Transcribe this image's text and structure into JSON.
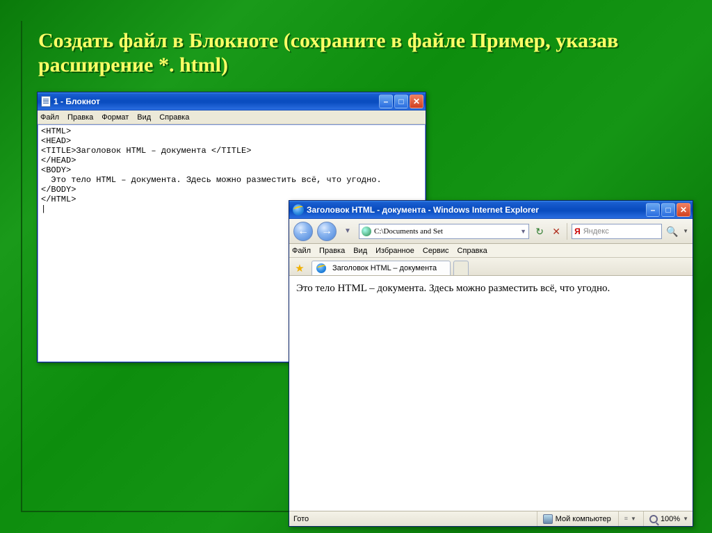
{
  "slide": {
    "title": "Создать файл в Блокноте (сохраните в файле Пример,  указав расширение  *. html)"
  },
  "notepad": {
    "title": "1 - Блокнот",
    "menu": {
      "file": "Файл",
      "edit": "Правка",
      "format": "Формат",
      "view": "Вид",
      "help": "Справка"
    },
    "content": "<HTML>\n<HEAD>\n<TITLE>Заголовок HTML – документа </TITLE>\n</HEAD>\n<BODY>\n  Это тело HTML – документа. Здесь можно разместить всё, что угодно.\n</BODY>\n</HTML>\n|"
  },
  "ie": {
    "title": "Заголовок HTML - документа - Windows Internet Explorer",
    "address": "C:\\Documents and Set",
    "search_placeholder": "Яндекс",
    "menu": {
      "file": "Файл",
      "edit": "Правка",
      "view": "Вид",
      "fav": "Избранное",
      "tools": "Сервис",
      "help": "Справка"
    },
    "tab_label": "Заголовок HTML – документа",
    "body_text": "Это тело HTML – документа. Здесь можно разместить всё, что угодно.",
    "status": {
      "ready": "Гото",
      "zone": "Мой компьютер",
      "zoom": "100%"
    },
    "glyphs": {
      "back": "←",
      "fwd": "→",
      "dd": "▼",
      "refresh": "↻",
      "stop": "✕",
      "search": "🔍",
      "minimize": "–",
      "maximize": "□",
      "close": "✕"
    }
  }
}
